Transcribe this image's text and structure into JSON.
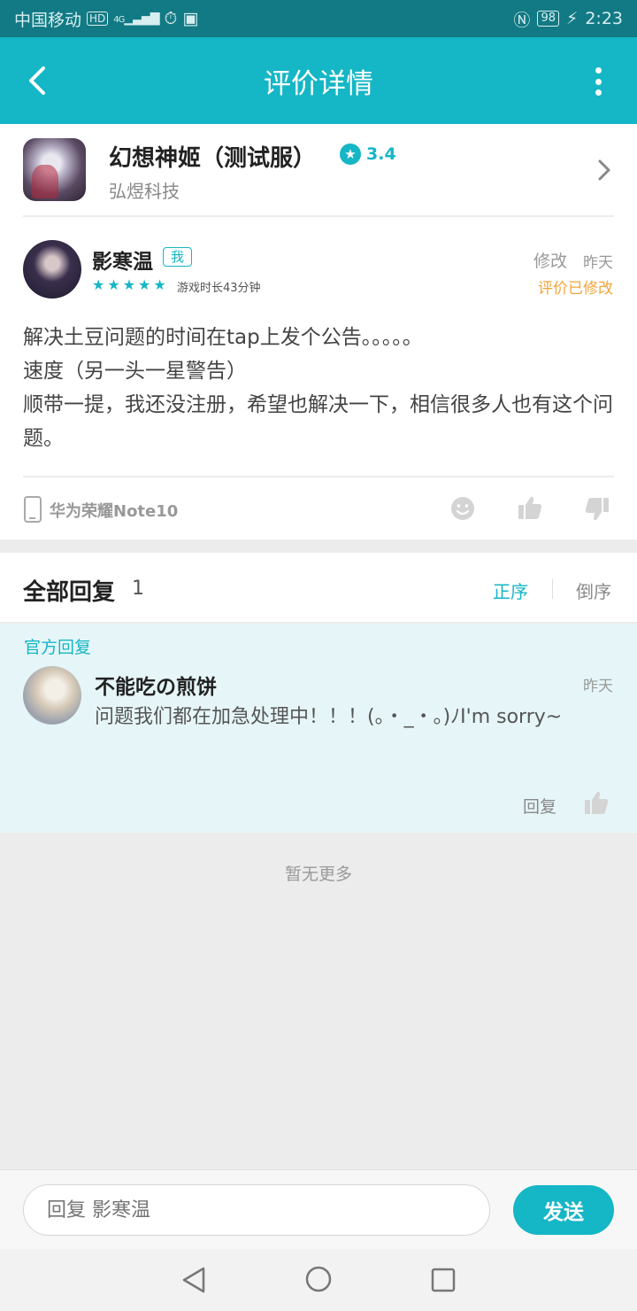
{
  "status_bar": {
    "carrier": "中国移动",
    "hd": "HD",
    "network": "4G",
    "battery": "98",
    "time": "2:23"
  },
  "header": {
    "title": "评价详情"
  },
  "game": {
    "name": "幻想神姬（测试服）",
    "rating": "3.4",
    "developer": "弘煜科技"
  },
  "review": {
    "username": "影寒温",
    "me_tag": "我",
    "stars": 5,
    "playtime": "游戏时长43分钟",
    "edit_label": "修改",
    "time": "昨天",
    "edited_note": "评价已修改",
    "text": "解决土豆问题的时间在tap上发个公告。。。。。\n速度（另一头一星警告）\n顺带一提，我还没注册，希望也解决一下，相信很多人也有这个问题。",
    "device": "华为荣耀Note10"
  },
  "replies": {
    "title": "全部回复",
    "count": "1",
    "sort_asc": "正序",
    "sort_desc": "倒序",
    "official_label": "官方回复",
    "official_name": "不能吃の煎饼",
    "official_time": "昨天",
    "official_text": "问题我们都在加急处理中！！！(。・_・。)ﾉI'm sorry~",
    "reply_label": "回复",
    "no_more": "暂无更多"
  },
  "input_bar": {
    "placeholder": "回复 影寒温",
    "send_label": "发送"
  },
  "colors": {
    "accent": "#15b6c5",
    "status_bar": "#127a84",
    "edited": "#f1a53a"
  }
}
